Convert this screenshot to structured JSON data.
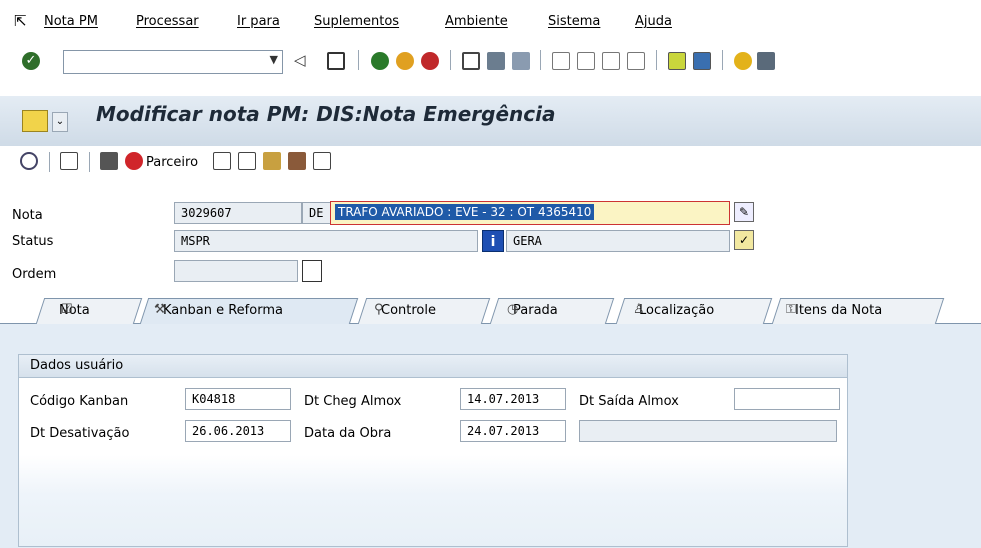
{
  "menu": {
    "items": [
      "Nota PM",
      "Processar",
      "Ir para",
      "Suplementos",
      "Ambiente",
      "Sistema",
      "Ajuda"
    ]
  },
  "toolbar": {
    "command_value": "",
    "icons": [
      "enter-icon",
      "dropdown-icon",
      "back-icon",
      "save-icon",
      "back-green-icon",
      "exit-icon",
      "cancel-icon",
      "print-icon",
      "find-icon",
      "find-next-icon",
      "first-page-icon",
      "prev-page-icon",
      "next-page-icon",
      "last-page-icon",
      "create-session-icon",
      "shortcut-icon",
      "help-icon",
      "layout-icon"
    ]
  },
  "title": {
    "text": "Modificar nota PM: DIS:Nota Emergência"
  },
  "app_toolbar": {
    "partner_label": "Parceiro"
  },
  "header": {
    "nota_label": "Nota",
    "nota_value": "3029607",
    "nota_type": "DE",
    "nota_desc": "TRAFO AVARIADO : EVE - 32 : OT 4365410",
    "status_label": "Status",
    "status_value": "MSPR",
    "status_user": "GERA",
    "ordem_label": "Ordem",
    "ordem_value": ""
  },
  "tabs": [
    {
      "label": "Nota",
      "icon": "edit-icon"
    },
    {
      "label": "Kanban e Reforma",
      "icon": "tools-icon"
    },
    {
      "label": "Controle",
      "icon": "magnifier-icon"
    },
    {
      "label": "Parada",
      "icon": "clock-icon"
    },
    {
      "label": "Localização",
      "icon": "person-icon"
    },
    {
      "label": "Itens da Nota",
      "icon": "keys-icon"
    }
  ],
  "group": {
    "title": "Dados usuário",
    "codigo_kanban_label": "Código Kanban",
    "codigo_kanban_value": "K04818",
    "dt_cheg_almox_label": "Dt Cheg Almox",
    "dt_cheg_almox_value": "14.07.2013",
    "dt_saida_almox_label": "Dt Saída Almox",
    "dt_saida_almox_value": "",
    "dt_desativacao_label": "Dt Desativação",
    "dt_desativacao_value": "26.06.2013",
    "data_obra_label": "Data da Obra",
    "data_obra_value": "24.07.2013"
  },
  "colors": {
    "title_band": "#cfdbe7",
    "selection": "#1f5aa8",
    "tab_content": "#e3ecf5"
  }
}
